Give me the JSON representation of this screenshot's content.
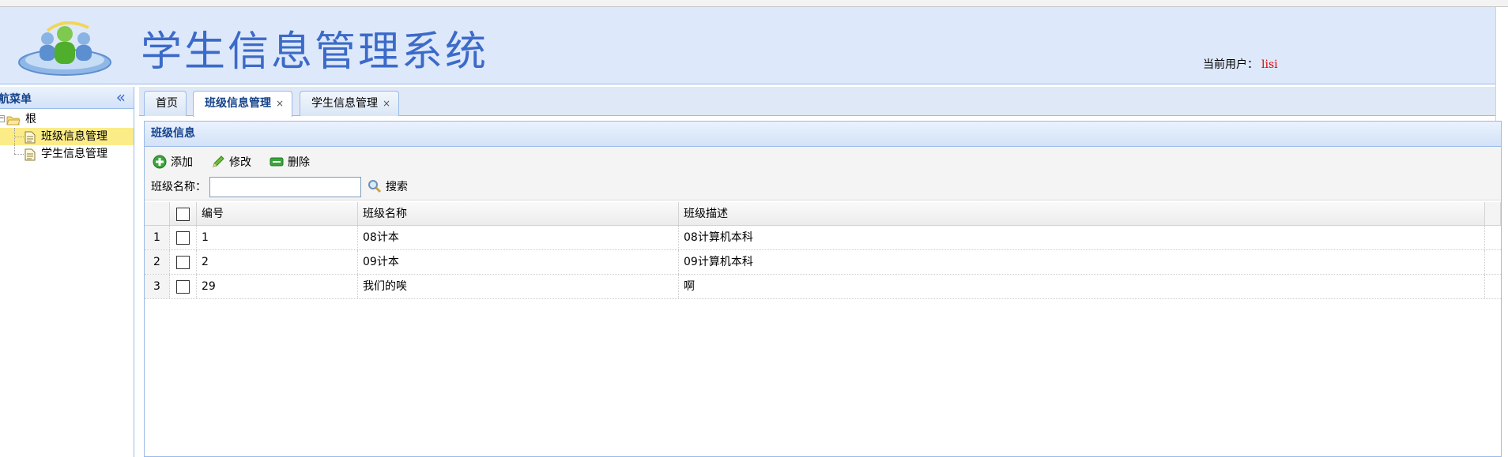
{
  "header": {
    "app_title": "学生信息管理系统",
    "user_label": "当前用户：",
    "user_name": "lisi"
  },
  "nav": {
    "title": "导航菜单",
    "collapse_icon": "double-chevron-left-icon",
    "tree": {
      "root_label": "根",
      "items": [
        {
          "label": "班级信息管理",
          "selected": true
        },
        {
          "label": "学生信息管理",
          "selected": false
        }
      ]
    }
  },
  "tabs": [
    {
      "label": "首页",
      "closable": false,
      "active": false
    },
    {
      "label": "班级信息管理",
      "closable": true,
      "active": true
    },
    {
      "label": "学生信息管理",
      "closable": true,
      "active": false
    }
  ],
  "tab_close_glyph": "×",
  "panel": {
    "title": "班级信息",
    "toolbar": {
      "add_label": "添加",
      "edit_label": "修改",
      "delete_label": "删除"
    },
    "search": {
      "label": "班级名称：",
      "value": "",
      "button_label": "搜索"
    }
  },
  "grid": {
    "columns": [
      "编号",
      "班级名称",
      "班级描述"
    ],
    "rows": [
      {
        "num": "1",
        "id": "1",
        "name": "08计本",
        "desc": "08计算机本科"
      },
      {
        "num": "2",
        "id": "2",
        "name": "09计本",
        "desc": "09计算机本科"
      },
      {
        "num": "3",
        "id": "29",
        "name": "我们的唉",
        "desc": "啊"
      }
    ]
  },
  "colors": {
    "title_blue": "#3c6ac8",
    "header_bg": "#dde9fb",
    "selected_row": "#fbec88",
    "user_name_red": "#e00000"
  }
}
